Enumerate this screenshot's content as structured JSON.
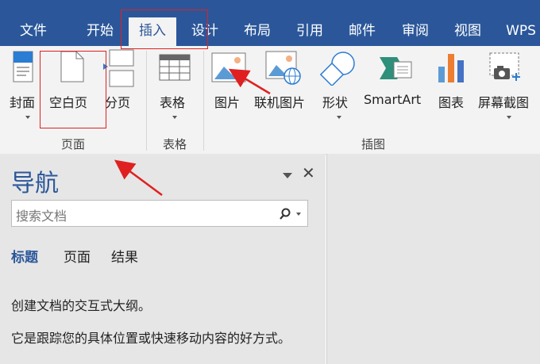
{
  "tabs": [
    {
      "label": "文件"
    },
    {
      "label": "开始"
    },
    {
      "label": "插入"
    },
    {
      "label": "设计"
    },
    {
      "label": "布局"
    },
    {
      "label": "引用"
    },
    {
      "label": "邮件"
    },
    {
      "label": "审阅"
    },
    {
      "label": "视图"
    },
    {
      "label": "WPS"
    }
  ],
  "ribbon": {
    "pages": {
      "cover": "封面",
      "blank": "空白页",
      "break": "分页",
      "group": "页面"
    },
    "tables": {
      "table": "表格",
      "group": "表格"
    },
    "illustrations": {
      "picture": "图片",
      "online_picture": "联机图片",
      "shapes": "形状",
      "smartart": "SmartArt",
      "chart": "图表",
      "screenshot": "屏幕截图",
      "group": "插图"
    }
  },
  "nav": {
    "title": "导航",
    "search_placeholder": "搜索文档",
    "tabs": [
      {
        "label": "标题"
      },
      {
        "label": "页面"
      },
      {
        "label": "结果"
      }
    ],
    "body_line1": "创建文档的交互式大纲。",
    "body_line2": "它是跟踪您的具体位置或快速移动内容的好方式。"
  },
  "colors": {
    "brand": "#2b579a",
    "annotation": "#e02020"
  }
}
